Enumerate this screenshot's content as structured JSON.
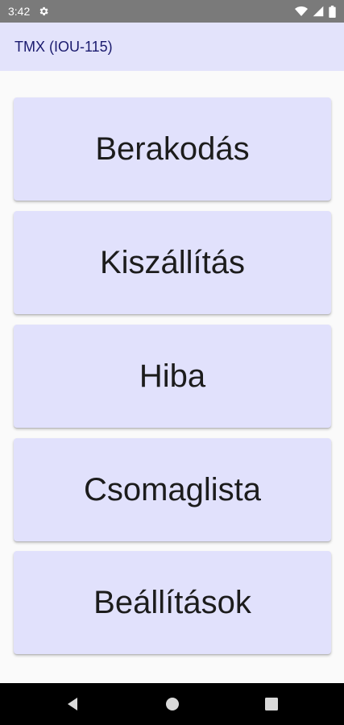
{
  "status_bar": {
    "time": "3:42",
    "icons": [
      "settings-gear-icon",
      "wifi-icon",
      "cellular-signal-icon",
      "battery-icon"
    ]
  },
  "app_bar": {
    "title": "TMX (IOU-115)",
    "background": "#e3e3fb",
    "title_color": "#1a1a6e"
  },
  "menu": {
    "button_color": "#e1e1fc",
    "items": [
      {
        "label": "Berakodás"
      },
      {
        "label": "Kiszállítás"
      },
      {
        "label": "Hiba"
      },
      {
        "label": "Csomaglista"
      },
      {
        "label": "Beállítások"
      }
    ]
  },
  "nav_bar": {
    "icons": [
      "back-icon",
      "home-icon",
      "recents-icon"
    ]
  }
}
